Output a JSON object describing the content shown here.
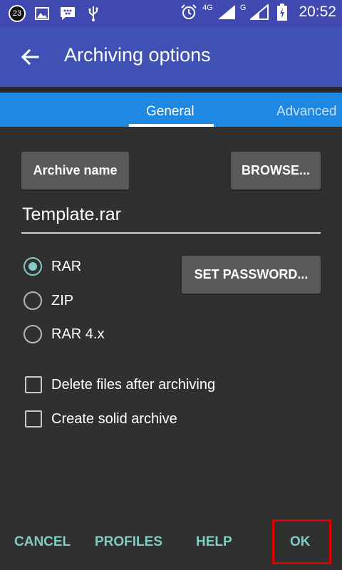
{
  "status_bar": {
    "notification_count": "23",
    "network_4g": "4G",
    "network_g": "G",
    "time": "20:52",
    "icons": [
      "image-icon",
      "chat-icon",
      "usb-icon",
      "alarm-icon",
      "signal-icon",
      "signal-icon",
      "battery-charging-icon"
    ]
  },
  "toolbar": {
    "back_icon": "arrow-back-icon",
    "title": "Archiving options"
  },
  "tabs": [
    {
      "label": "General",
      "selected": true
    },
    {
      "label": "Advanced",
      "selected": false
    }
  ],
  "general": {
    "archive_name_button": "Archive name",
    "browse_button": "BROWSE...",
    "archive_name_value": "Template.rar",
    "set_password_button": "SET PASSWORD...",
    "formats": [
      {
        "label": "RAR",
        "selected": true
      },
      {
        "label": "ZIP",
        "selected": false
      },
      {
        "label": "RAR 4.x",
        "selected": false
      }
    ],
    "options": [
      {
        "label": "Delete files after archiving",
        "checked": false
      },
      {
        "label": "Create solid archive",
        "checked": false
      }
    ]
  },
  "footer": {
    "cancel": "CANCEL",
    "profiles": "PROFILES",
    "help": "HELP",
    "ok": "OK"
  },
  "colors": {
    "toolbar": "#3f51b5",
    "status_bar": "#3f49b0",
    "tabs": "#1e88e5",
    "background": "#303030",
    "accent": "#80cbc4",
    "highlight": "#e00000"
  }
}
